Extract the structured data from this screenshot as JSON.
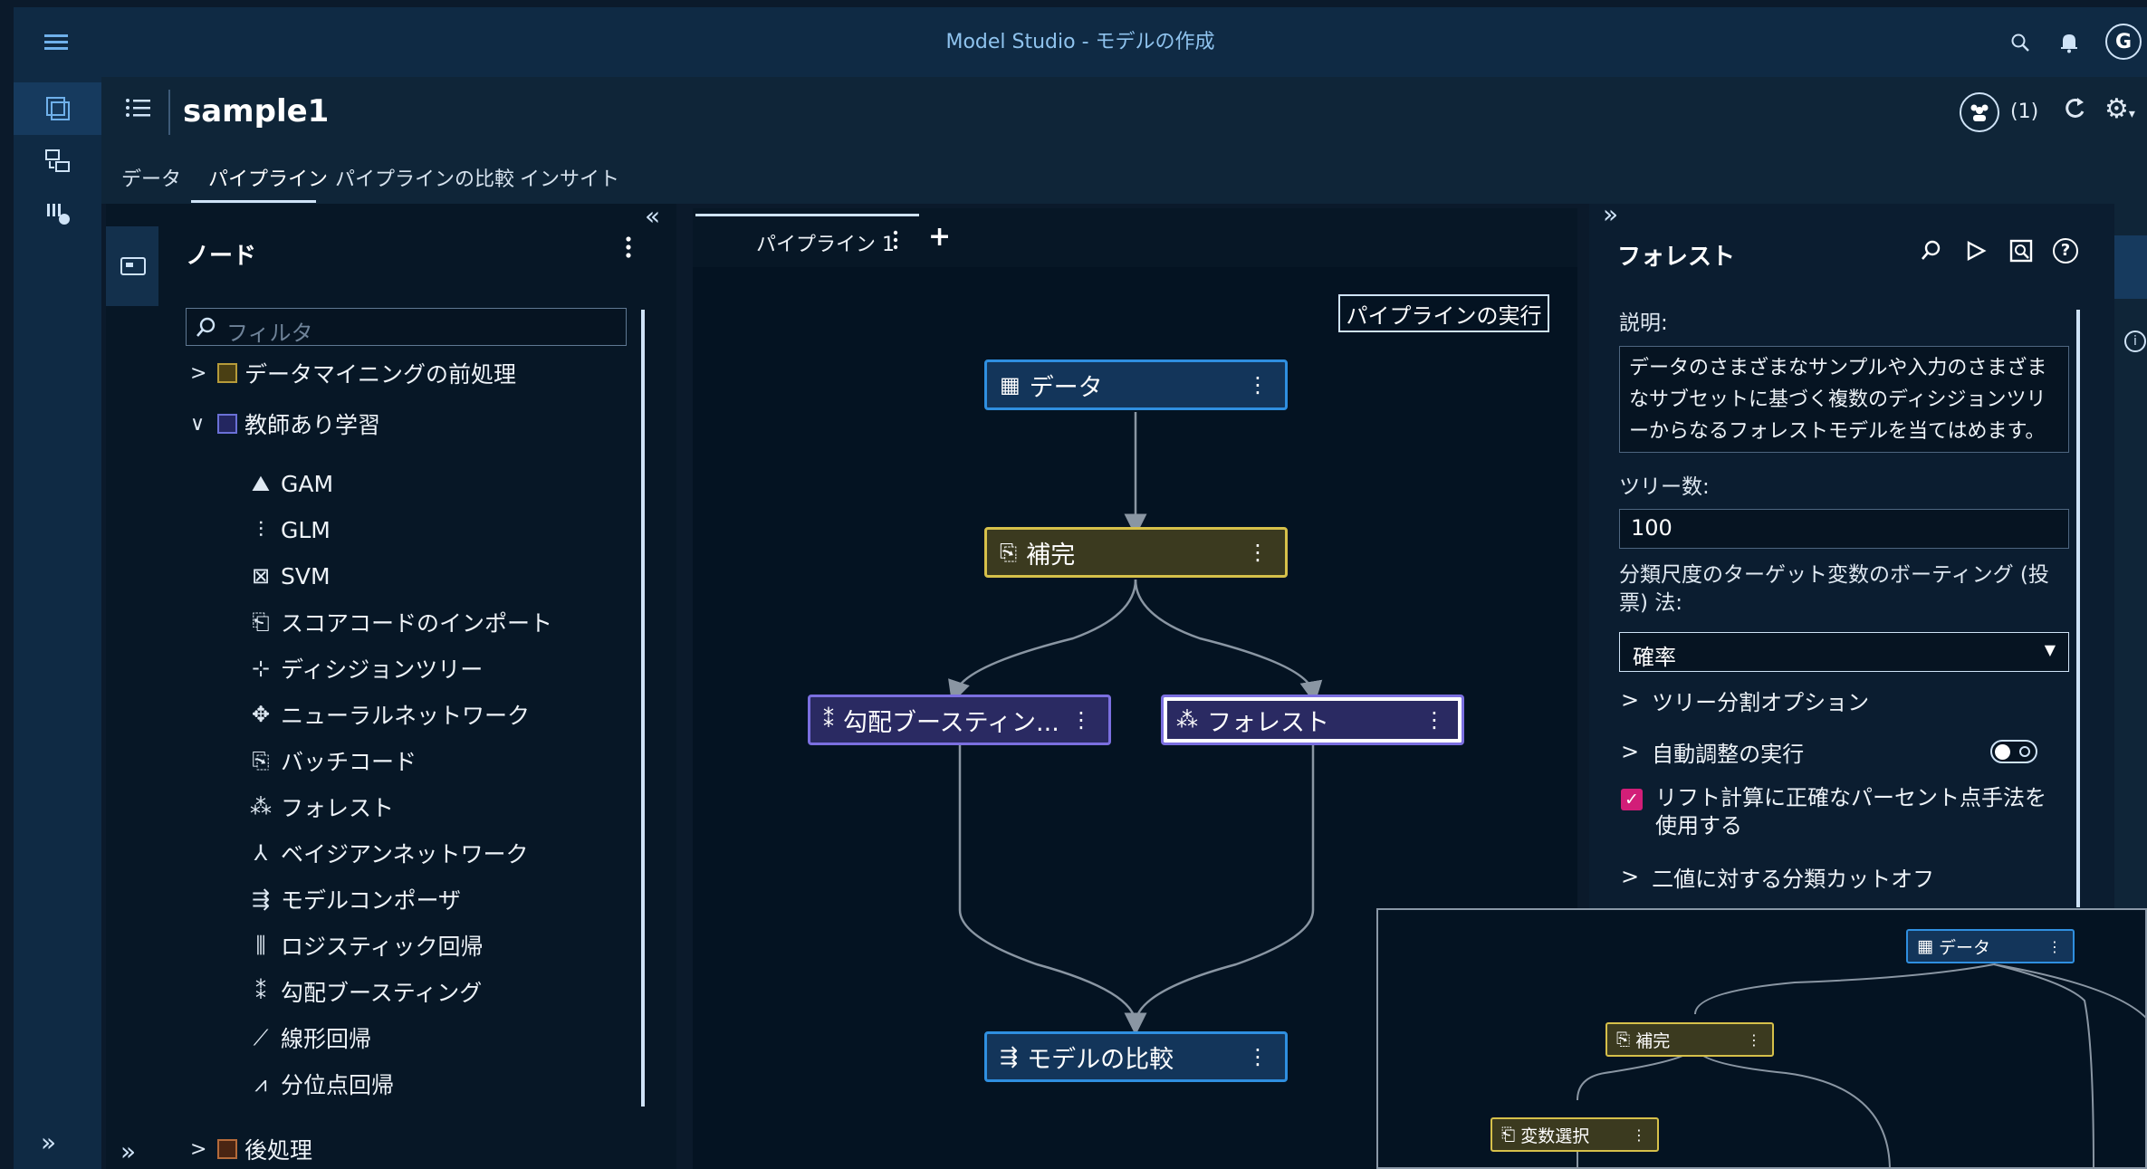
{
  "app": {
    "title": "Model Studio - モデルの作成",
    "user_initial": "G"
  },
  "header": {
    "project_name": "sample1",
    "collaborators_count": "(1)",
    "tabs": [
      {
        "label": "データ"
      },
      {
        "label": "パイプライン"
      },
      {
        "label": "パイプラインの比較"
      },
      {
        "label": "インサイト"
      }
    ]
  },
  "node_panel": {
    "title": "ノード",
    "filter_placeholder": "フィルタ",
    "categories": {
      "preprocess": {
        "label": "データマイニングの前処理",
        "color": "#8a7a2e"
      },
      "supervised": {
        "label": "教師あり学習",
        "color": "#4a4fa3"
      },
      "postprocess": {
        "label": "後処理",
        "color": "#8a4a2e"
      }
    },
    "items": [
      {
        "label": "GAM",
        "icon": "gam-icon"
      },
      {
        "label": "GLM",
        "icon": "glm-icon"
      },
      {
        "label": "SVM",
        "icon": "svm-icon"
      },
      {
        "label": "スコアコードのインポート",
        "icon": "score-code-icon"
      },
      {
        "label": "ディシジョンツリー",
        "icon": "decision-tree-icon"
      },
      {
        "label": "ニューラルネットワーク",
        "icon": "neural-network-icon"
      },
      {
        "label": "バッチコード",
        "icon": "batch-code-icon"
      },
      {
        "label": "フォレスト",
        "icon": "forest-icon"
      },
      {
        "label": "ベイジアンネットワーク",
        "icon": "bayesian-network-icon"
      },
      {
        "label": "モデルコンポーザ",
        "icon": "model-composer-icon"
      },
      {
        "label": "ロジスティック回帰",
        "icon": "logistic-regression-icon"
      },
      {
        "label": "勾配ブースティング",
        "icon": "gradient-boosting-icon"
      },
      {
        "label": "線形回帰",
        "icon": "linear-regression-icon"
      },
      {
        "label": "分位点回帰",
        "icon": "quantile-regression-icon"
      }
    ]
  },
  "pipeline": {
    "tab_label": "パイプライン 1",
    "add_label": "+",
    "run_button": "パイプラインの実行",
    "nodes": {
      "data": "データ",
      "impute": "補完",
      "gradient": "勾配ブースティン...",
      "forest": "フォレスト",
      "compare": "モデルの比較"
    }
  },
  "properties": {
    "title": "フォレスト",
    "description_label": "説明:",
    "description": "データのさまざまなサンプルや入力のさまざまなサブセットに基づく複数のディシジョンツリーからなるフォレストモデルを当てはめます。",
    "tree_count_label": "ツリー数:",
    "tree_count_value": "100",
    "voting_label": "分類尺度のターゲット変数のボーティング (投票) 法:",
    "voting_value": "確率",
    "split_options_label": "ツリー分割オプション",
    "autotune_label": "自動調整の実行",
    "autotune_enabled": false,
    "lift_label": "リフト計算に正確なパーセント点手法を使用する",
    "lift_checked": true,
    "binary_cutoff_label": "二値に対する分類カットオフ"
  },
  "minimap": {
    "nodes": {
      "data": "データ",
      "impute": "補完",
      "varsel": "変数選択"
    }
  },
  "colors": {
    "accent_blue": "#2f8fe0",
    "impute_yellow": "#d6c04a",
    "purple": "#7b6fe0",
    "checkbox_pink": "#d21e78"
  }
}
